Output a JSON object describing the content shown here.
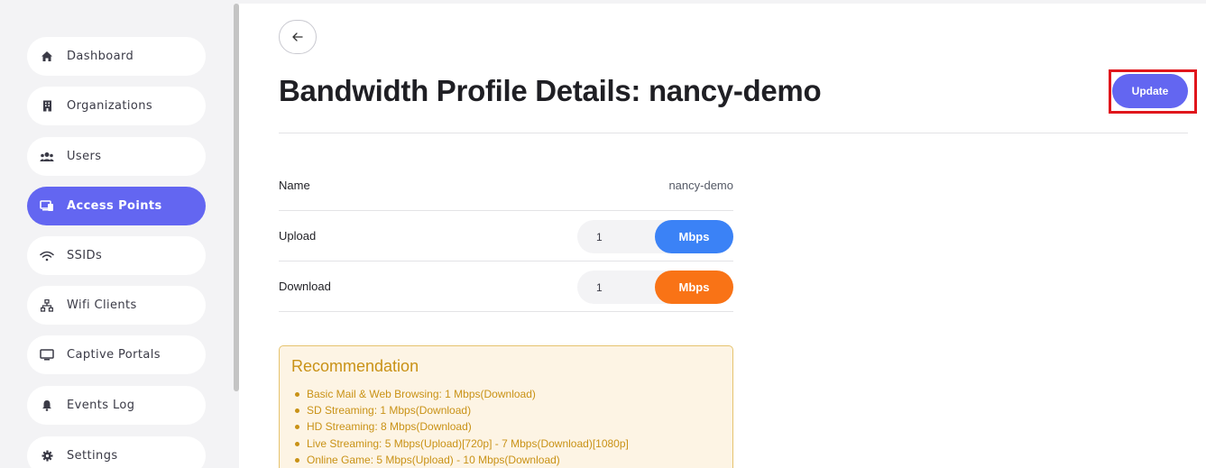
{
  "sidebar": {
    "items": [
      {
        "label": "Dashboard",
        "icon": "home-icon"
      },
      {
        "label": "Organizations",
        "icon": "building-icon"
      },
      {
        "label": "Users",
        "icon": "users-icon"
      },
      {
        "label": "Access Points",
        "icon": "devices-icon",
        "active": true
      },
      {
        "label": "SSIDs",
        "icon": "wifi-icon"
      },
      {
        "label": "Wifi Clients",
        "icon": "network-icon"
      },
      {
        "label": "Captive Portals",
        "icon": "monitor-icon"
      },
      {
        "label": "Events Log",
        "icon": "bell-icon"
      },
      {
        "label": "Settings",
        "icon": "gear-icon"
      }
    ]
  },
  "header": {
    "back_icon": "arrow-left-icon",
    "title": "Bandwidth Profile Details: nancy-demo",
    "update_label": "Update"
  },
  "details": {
    "name_label": "Name",
    "name_value": "nancy-demo",
    "upload_label": "Upload",
    "upload_value": "1",
    "upload_unit": "Mbps",
    "download_label": "Download",
    "download_value": "1",
    "download_unit": "Mbps"
  },
  "recommendation": {
    "title": "Recommendation",
    "items": [
      "Basic Mail & Web Browsing: 1 Mbps(Download)",
      "SD Streaming: 1 Mbps(Download)",
      "HD Streaming: 8 Mbps(Download)",
      "Live Streaming: 5 Mbps(Upload)[720p] - 7 Mbps(Download)[1080p]",
      "Online Game: 5 Mbps(Upload) - 10 Mbps(Download)"
    ]
  },
  "colors": {
    "accent": "#6366f1",
    "upload_unit": "#3b82f6",
    "download_unit": "#f97316",
    "recommendation_text": "#c99216",
    "highlight": "#e0161c"
  }
}
